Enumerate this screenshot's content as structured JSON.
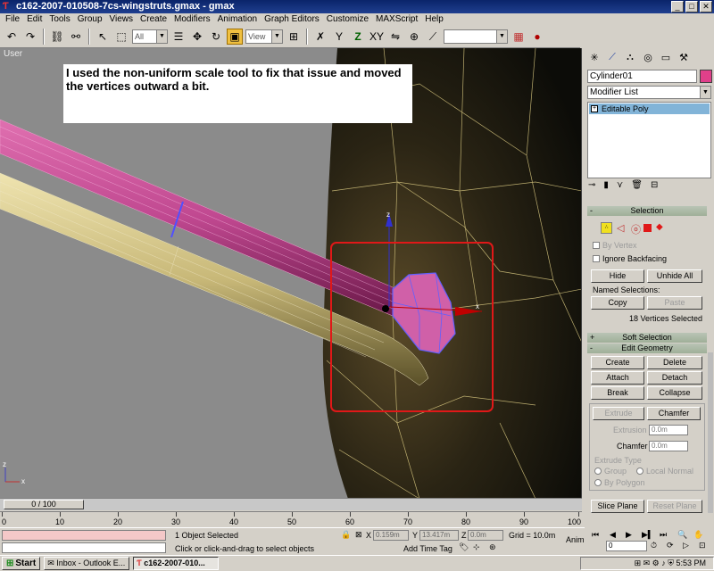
{
  "window": {
    "title": "c162-2007-010508-7cs-wingstruts.gmax - gmax",
    "minimize": "_",
    "maximize": "□",
    "close": "✕"
  },
  "menu": [
    "File",
    "Edit",
    "Tools",
    "Group",
    "Views",
    "Create",
    "Modifiers",
    "Animation",
    "Graph Editors",
    "Customize",
    "MAXScript",
    "Help"
  ],
  "toolbar": {
    "selection_filter": "All",
    "ref_coord": "View",
    "named_sel": ""
  },
  "viewport": {
    "label": "User",
    "note": "I used the non-uniform scale tool to fix that issue and moved the vertices outward a bit.",
    "gizmo_z": "z",
    "gizmo_x": "x",
    "axis_z": "z",
    "axis_x": "x"
  },
  "command_panel": {
    "object_name": "Cylinder01",
    "modifier_list": "Modifier List",
    "stack_item": "Editable Poly",
    "selection": {
      "title": "Selection",
      "by_vertex": "By Vertex",
      "ignore_backfacing": "Ignore Backfacing",
      "hide": "Hide",
      "unhide_all": "Unhide All",
      "named_selections": "Named Selections:",
      "copy": "Copy",
      "paste": "Paste",
      "status": "18 Vertices Selected"
    },
    "soft_selection": {
      "title": "Soft Selection"
    },
    "edit_geometry": {
      "title": "Edit Geometry",
      "create": "Create",
      "delete": "Delete",
      "attach": "Attach",
      "detach": "Detach",
      "break": "Break",
      "collapse": "Collapse",
      "extrude": "Extrude",
      "chamfer": "Chamfer",
      "extrusion_label": "Extrusion",
      "extrusion_value": "0.0m",
      "chamfer_label": "Chamfer",
      "chamfer_value": "0.0m",
      "extrude_type": "Extrude Type",
      "group": "Group",
      "local_normal": "Local Normal",
      "by_polygon": "By Polygon",
      "slice_plane": "Slice Plane",
      "reset_plane": "Reset Plane"
    }
  },
  "timeline": {
    "slider": "0 / 100",
    "ticks": [
      "0",
      "10",
      "20",
      "30",
      "40",
      "50",
      "60",
      "70",
      "80",
      "90",
      "100"
    ]
  },
  "status": {
    "selected": "1 Object Selected",
    "prompt": "Click or click-and-drag to select objects",
    "x_label": "X",
    "x_value": "0.159m",
    "y_label": "Y",
    "y_value": "13.417m",
    "z_label": "Z",
    "z_value": "0.0m",
    "grid": "Grid = 10.0m",
    "add_time_tag": "Add Time Tag",
    "anim": "Anim.",
    "frame": "0"
  },
  "taskbar": {
    "start": "Start",
    "tasks": [
      "Inbox - Outlook E...",
      "c162-2007-010..."
    ],
    "clock": "5:53 PM"
  },
  "colors": {
    "titlebar": "#0a246a",
    "viewport_bg": "#8b8b8b",
    "selection_box": "#e01818",
    "pink_strut": "#c84890",
    "yellow_strut": "#d8c888",
    "rollout_header": "#a8b8a0"
  }
}
